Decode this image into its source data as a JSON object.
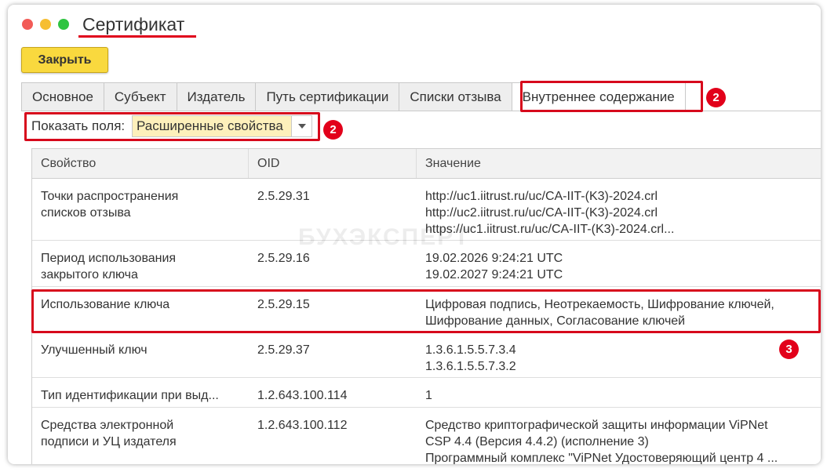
{
  "window": {
    "title": "Сертификат"
  },
  "toolbar": {
    "close_label": "Закрыть"
  },
  "tabs": [
    {
      "label": "Основное"
    },
    {
      "label": "Субъект"
    },
    {
      "label": "Издатель"
    },
    {
      "label": "Путь сертификации"
    },
    {
      "label": "Списки отзыва"
    },
    {
      "label": "Внутреннее содержание",
      "active": true
    }
  ],
  "filter": {
    "label": "Показать поля:",
    "selected": "Расширенные свойства"
  },
  "table": {
    "columns": [
      "Свойство",
      "OID",
      "Значение"
    ],
    "rows": [
      {
        "property": [
          "Точки распространения",
          "списков отзыва"
        ],
        "oid": "2.5.29.31",
        "value": [
          "http://uc1.iitrust.ru/uc/CA-IIT-(K3)-2024.crl",
          "http://uc2.iitrust.ru/uc/CA-IIT-(K3)-2024.crl",
          "https://uc1.iitrust.ru/uc/CA-IIT-(K3)-2024.crl..."
        ]
      },
      {
        "property": [
          "Период использования",
          "закрытого ключа"
        ],
        "oid": "2.5.29.16",
        "value": [
          "19.02.2026 9:24:21 UTC",
          "19.02.2027 9:24:21 UTC"
        ]
      },
      {
        "property": [
          "Использование ключа"
        ],
        "oid": "2.5.29.15",
        "value": [
          "Цифровая подпись, Неотрекаемость, Шифрование ключей,",
          "Шифрование данных, Согласование ключей"
        ]
      },
      {
        "property": [
          "Улучшенный ключ"
        ],
        "oid": "2.5.29.37",
        "value": [
          "1.3.6.1.5.5.7.3.4",
          "1.3.6.1.5.5.7.3.2"
        ]
      },
      {
        "property": [
          "Тип идентификации при выд..."
        ],
        "oid": "1.2.643.100.114",
        "value": [
          "1"
        ]
      },
      {
        "property": [
          "Средства электронной",
          "подписи и УЦ издателя"
        ],
        "oid": "1.2.643.100.112",
        "value": [
          "Средство криптографической защиты информации ViPNet",
          "CSP 4.4 (Версия 4.4.2) (исполнение 3)",
          "Программный комплекс \"ViPNet Удостоверяющий центр 4 ..."
        ]
      }
    ]
  },
  "annotations": {
    "badge_tabs": "2",
    "badge_filter": "2",
    "badge_row": "3"
  },
  "watermark": "БУХЭКСПЕРТ",
  "colors": {
    "accent_red": "#d7091c",
    "button_yellow": "#f9d93e",
    "select_bg": "#fdf0bb"
  }
}
